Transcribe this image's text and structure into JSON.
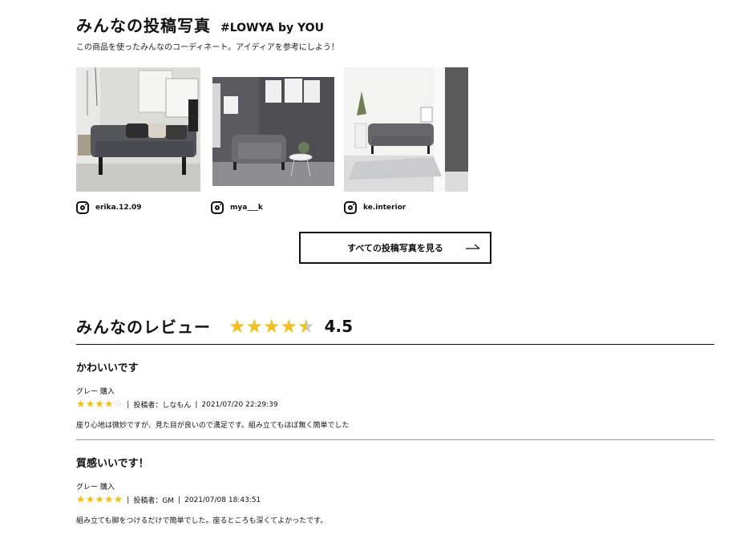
{
  "posts": {
    "title": "みんなの投稿写真",
    "hashtag": "#LOWYA by YOU",
    "description": "この商品を使ったみんなのコーディネート。アイディアを参考にしよう！",
    "photos": [
      {
        "username": "erika.12.09"
      },
      {
        "username": "mya___k"
      },
      {
        "username": "ke.interior"
      }
    ],
    "view_all_label": "すべての投稿写真を見る"
  },
  "reviews": {
    "title": "みんなのレビュー",
    "average_rating": 4.5,
    "average_rating_text": "4.5",
    "items": [
      {
        "title": "かわいいです",
        "variant": "グレー 購入",
        "rating": 4,
        "author": "投稿者：しなもん",
        "date": "2021/07/20 22:29:39",
        "body": "座り心地は微妙ですが、見た目が良いので満足です。組み立てもほぼ無く簡単でした"
      },
      {
        "title": "質感いいです！",
        "variant": "グレー 購入",
        "rating": 5,
        "author": "投稿者：GM",
        "date": "2021/07/08 18:43:51",
        "body": "組み立ても脚をつけるだけで簡単でした。座るところも深くてよかったです。"
      }
    ]
  },
  "colors": {
    "star": "#f0c020",
    "star_empty": "#c8c8c8",
    "text": "#111111"
  }
}
